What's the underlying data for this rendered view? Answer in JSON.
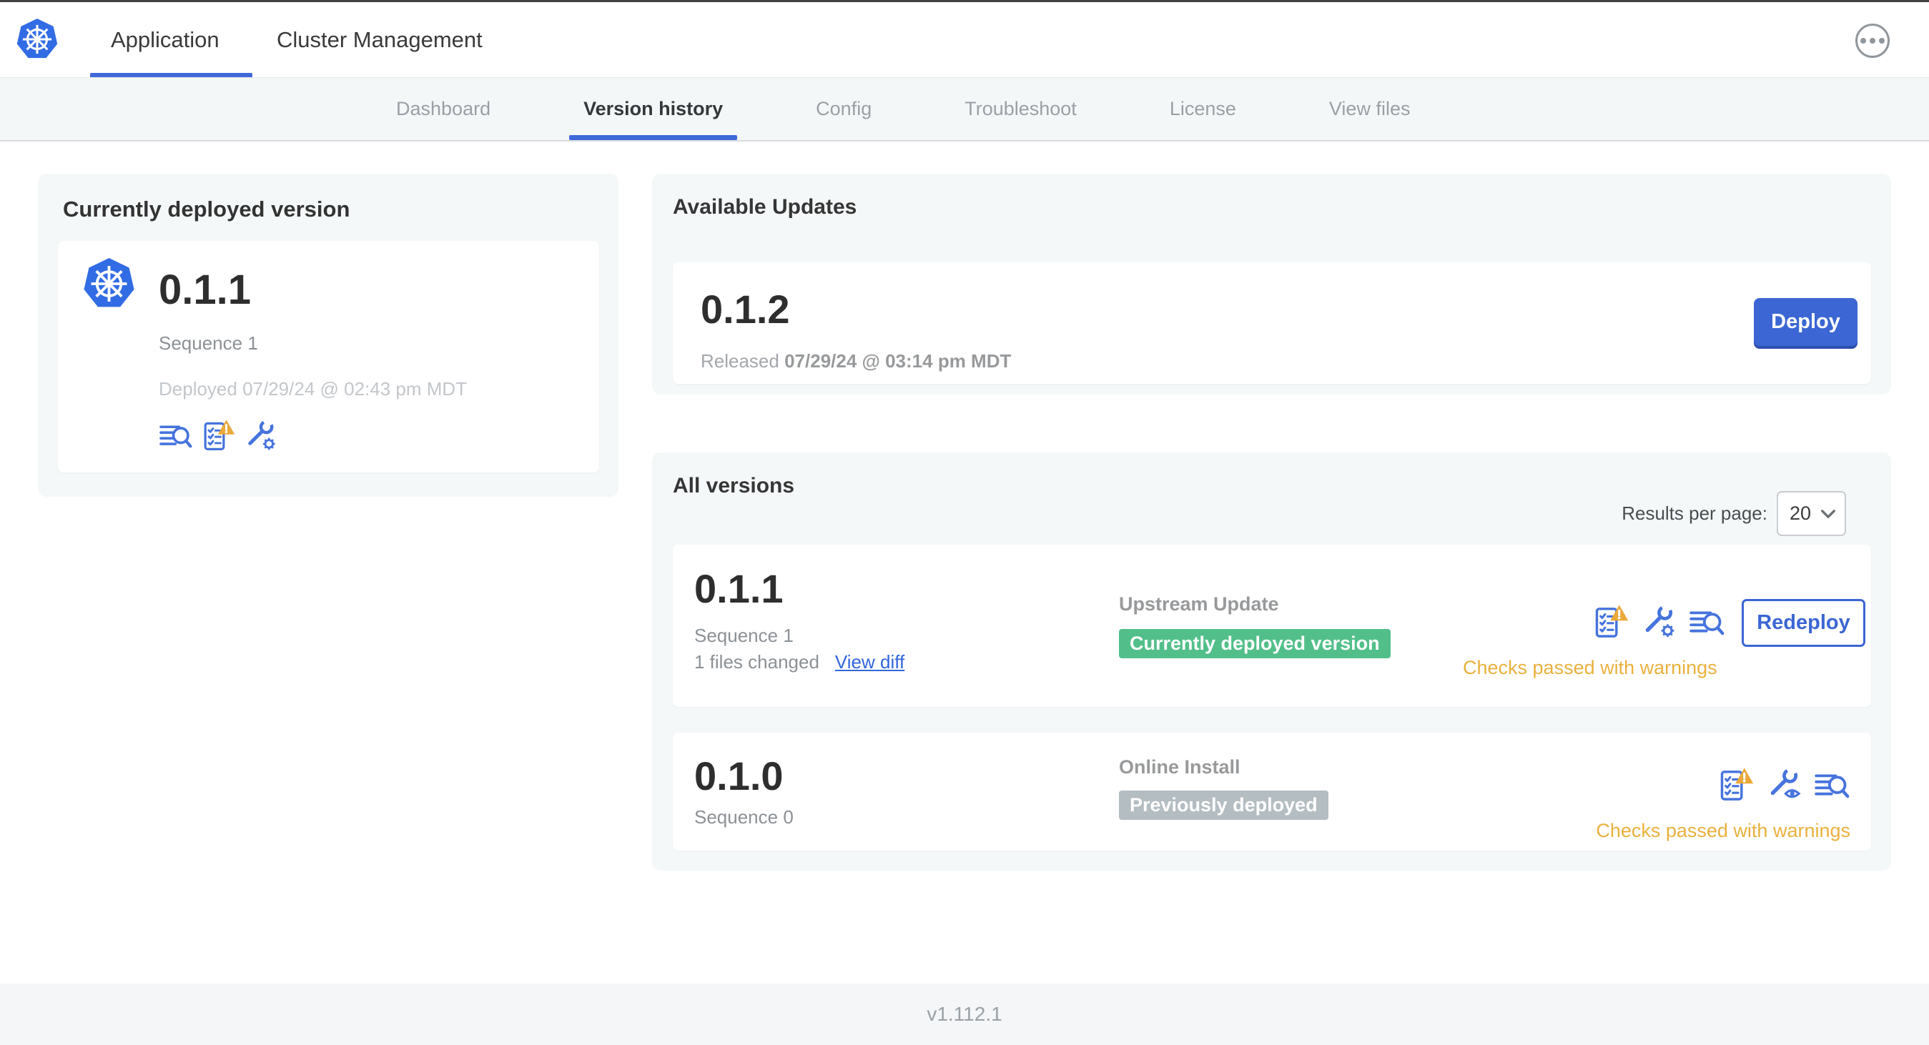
{
  "header": {
    "tabs": [
      {
        "label": "Application",
        "active": true
      },
      {
        "label": "Cluster Management",
        "active": false
      }
    ],
    "more_menu_icon": "ellipsis-icon"
  },
  "nav": {
    "items": [
      {
        "label": "Dashboard",
        "active": false
      },
      {
        "label": "Version history",
        "active": true
      },
      {
        "label": "Config",
        "active": false
      },
      {
        "label": "Troubleshoot",
        "active": false
      },
      {
        "label": "License",
        "active": false
      },
      {
        "label": "View files",
        "active": false
      }
    ]
  },
  "deployed_card": {
    "title": "Currently deployed version",
    "version": "0.1.1",
    "sequence": "Sequence 1",
    "deployed_at": "Deployed 07/29/24 @ 02:43 pm MDT",
    "icons": [
      "deploy-logs-icon",
      "preflight-checks-warning-icon",
      "config-wrench-gear-icon"
    ]
  },
  "available_updates": {
    "title": "Available Updates",
    "version": "0.1.2",
    "released_prefix": "Released",
    "released_date": "07/29/24 @ 03:14 pm MDT",
    "deploy_label": "Deploy"
  },
  "all_versions": {
    "title": "All versions",
    "results_per_page_label": "Results per page:",
    "results_per_page_value": "20",
    "rows": [
      {
        "version": "0.1.1",
        "sequence": "Sequence 1",
        "files_changed": "1 files changed",
        "view_diff_label": "View diff",
        "source": "Upstream Update",
        "badge_label": "Currently deployed version",
        "badge_color": "#52bf8a",
        "status": "Checks passed with warnings",
        "action_label": "Redeploy",
        "icons": [
          "preflight-checks-warning-icon",
          "config-wrench-gear-icon",
          "deploy-logs-icon"
        ]
      },
      {
        "version": "0.1.0",
        "sequence": "Sequence 0",
        "source": "Online Install",
        "badge_label": "Previously deployed",
        "badge_color": "#b4bdc1",
        "status": "Checks passed with warnings",
        "icons": [
          "preflight-checks-warning-icon",
          "config-wrench-eye-icon",
          "deploy-logs-icon"
        ]
      }
    ]
  },
  "footer": {
    "app_version": "v1.112.1"
  },
  "colors": {
    "accent_blue": "#3b66d3",
    "underline_blue": "#3f69d9",
    "icon_blue": "#4673dd",
    "link_blue": "#3166dd",
    "k8s_blue": "#326ce5",
    "green_badge": "#52bf8a",
    "gray_badge": "#b4bdc1",
    "warning_amber": "#e9b13e",
    "card_bg": "#f5f8f9",
    "nav_bg": "#f4f7f8"
  }
}
